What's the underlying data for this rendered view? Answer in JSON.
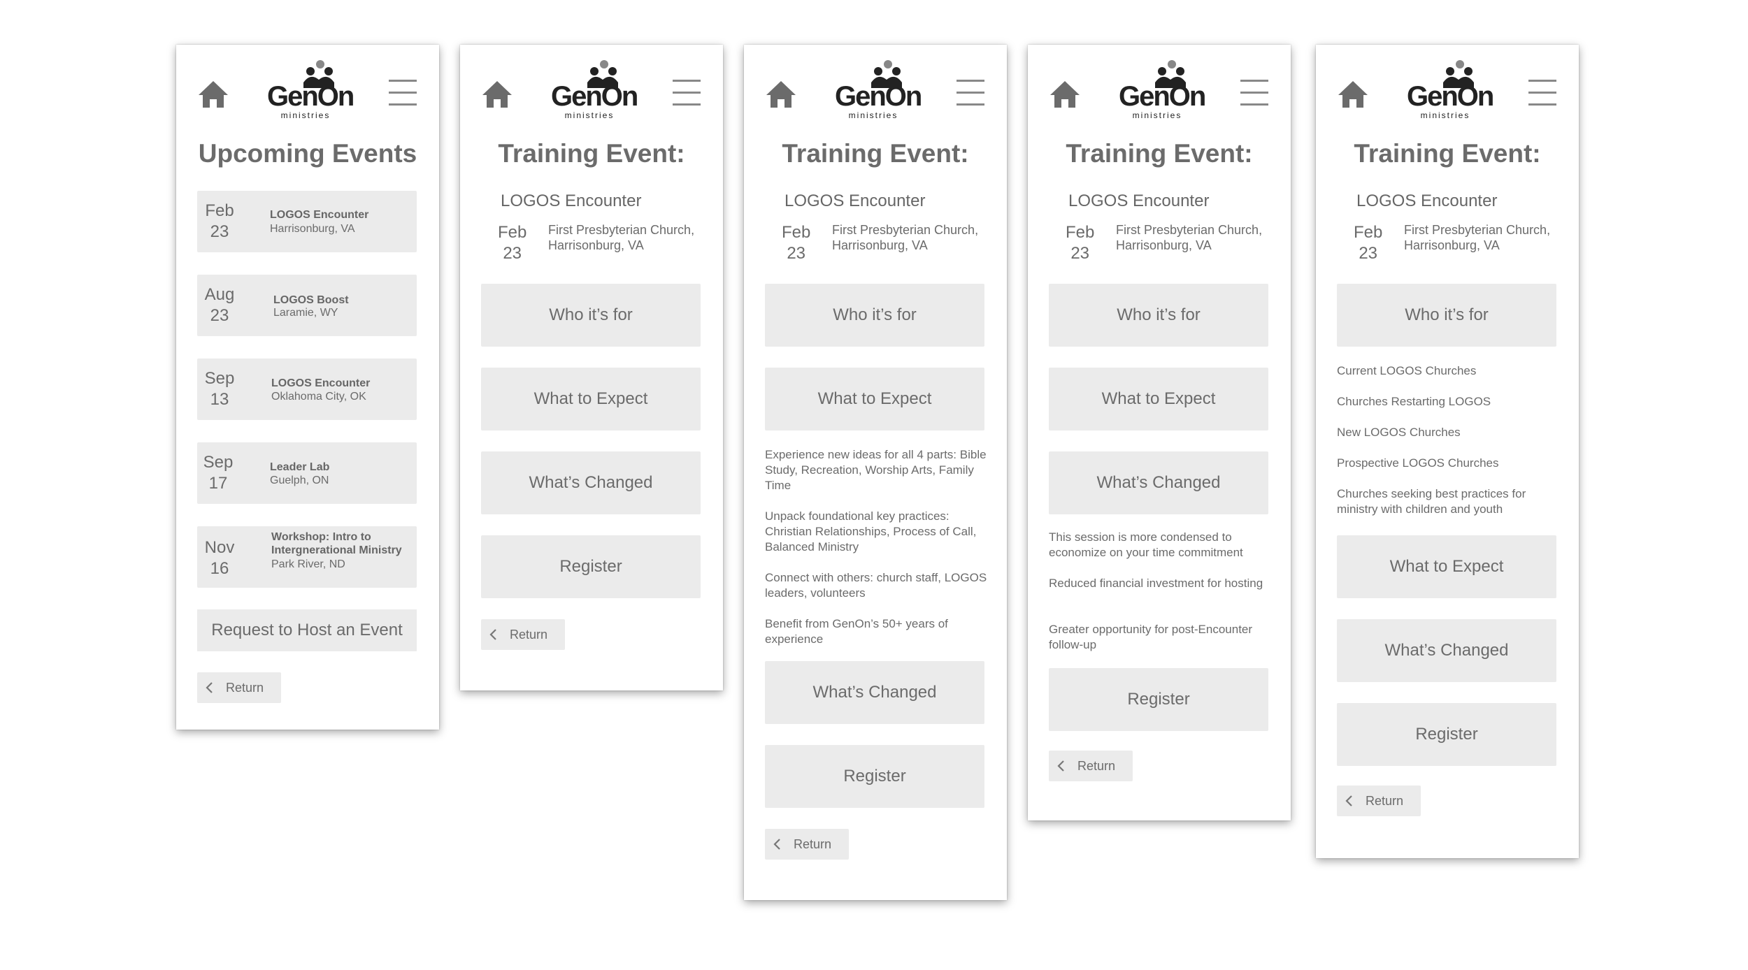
{
  "logo": {
    "text": "GenOn",
    "subtitle": "ministries"
  },
  "screen1": {
    "title": "Upcoming Events",
    "events": [
      {
        "month": "Feb",
        "day": "23",
        "title": "LOGOS Encounter",
        "location": "Harrisonburg, VA"
      },
      {
        "month": "Aug",
        "day": "23",
        "title": "LOGOS Boost",
        "location": "Laramie, WY"
      },
      {
        "month": "Sep",
        "day": "13",
        "title": "LOGOS Encounter",
        "location": "Oklahoma City, OK"
      },
      {
        "month": "Sep",
        "day": "17",
        "title": "Leader Lab",
        "location": "Guelph, ON"
      },
      {
        "month": "Nov",
        "day": "16",
        "title_line1": "Workshop: Intro to",
        "title_line2": "Intergnerational Ministry",
        "location": "Park River, ND"
      }
    ],
    "request_label": "Request to Host an Event",
    "return_label": "Return"
  },
  "training": {
    "title": "Training Event:",
    "event_name": "LOGOS Encounter",
    "month": "Feb",
    "day": "23",
    "venue_line1": "First Presbyterian Church,",
    "venue_line2": "Harrisonburg, VA",
    "who_label": "Who it’s for",
    "expect_label": "What to Expect",
    "changed_label": "What’s Changed",
    "register_label": "Register",
    "return_label": "Return"
  },
  "expect_details": [
    "Experience new ideas for all 4 parts: Bible Study, Recreation, Worship Arts, Family Time",
    "Unpack foundational key practices: Christian Relationships, Process of Call, Balanced Ministry",
    "Connect with others: church staff, LOGOS leaders, volunteers",
    "Benefit from GenOn’s 50+ years of experience"
  ],
  "changed_details": [
    "This session is more condensed to economize on your time commitment",
    "Reduced financial investment for hosting",
    "Greater opportunity for post-Encounter follow-up"
  ],
  "who_details": [
    "Current LOGOS Churches",
    "Churches Restarting LOGOS",
    "New LOGOS Churches",
    "Prospective LOGOS Churches",
    "Churches seeking best practices for ministry with children and youth"
  ],
  "colors": {
    "button_bg": "#ebebeb",
    "text": "#6b6b6b",
    "icon": "#6b6b6b"
  }
}
